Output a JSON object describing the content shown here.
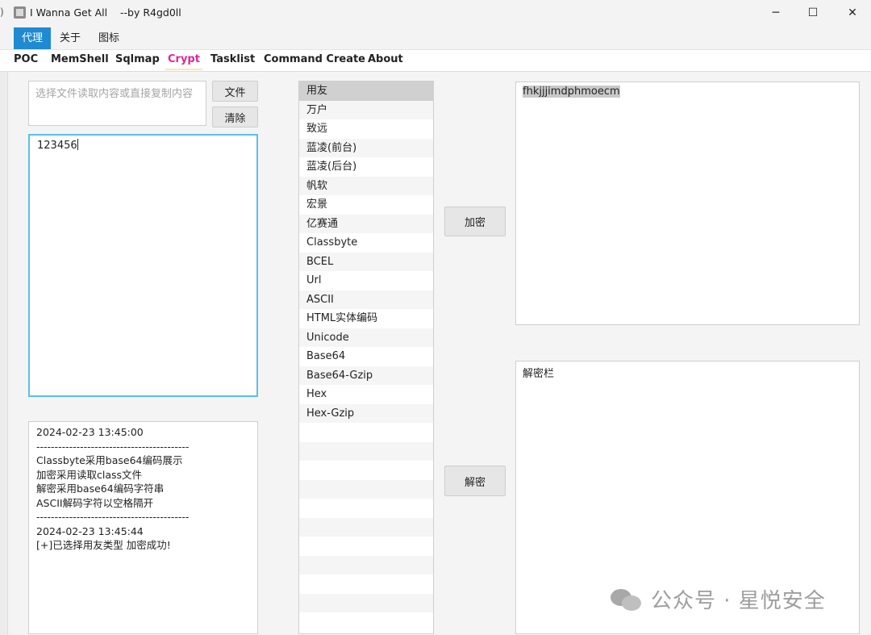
{
  "window": {
    "edge_glyph": ")",
    "title": "I Wanna Get All    --by R4gd0ll",
    "controls": {
      "minimize": "─",
      "maximize": "☐",
      "close": "✕"
    }
  },
  "menu": [
    "代理",
    "关于",
    "图标"
  ],
  "tabs": [
    "POC",
    "MemShell",
    "Sqlmap",
    "Crypt",
    "Tasklist",
    "Command Create",
    "About"
  ],
  "active_tab": "Crypt",
  "file_panel": {
    "placeholder": "选择文件读取内容或直接复制内容",
    "file_button": "文件",
    "clear_button": "清除"
  },
  "input": {
    "value": "123456"
  },
  "log": {
    "lines": [
      "2024-02-23 13:45:00",
      "------------------------------------------",
      "Classbyte采用base64编码展示",
      "加密采用读取class文件",
      "解密采用base64编码字符串",
      "ASCII解码字符以空格隔开",
      "------------------------------------------",
      "2024-02-23 13:45:44",
      "[+]已选择用友类型 加密成功!"
    ]
  },
  "types": {
    "items": [
      "用友",
      "万户",
      "致远",
      "蓝凌(前台)",
      "蓝凌(后台)",
      "帆软",
      "宏景",
      "亿赛通",
      "Classbyte",
      "BCEL",
      "Url",
      "ASCII",
      "HTML实体编码",
      "Unicode",
      "Base64",
      "Base64-Gzip",
      "Hex",
      "Hex-Gzip"
    ],
    "selected": "用友"
  },
  "actions": {
    "encrypt": "加密",
    "decrypt": "解密"
  },
  "encrypt_output": {
    "value": "fhkjjjimdphmoecm"
  },
  "decrypt_output": {
    "value": "解密栏"
  },
  "watermark": {
    "text": "公众号 · 星悦安全"
  },
  "colors": {
    "active_menu": "#1f8ad2",
    "active_tab": "#e0249a",
    "focus_border": "#5bc0e8"
  }
}
